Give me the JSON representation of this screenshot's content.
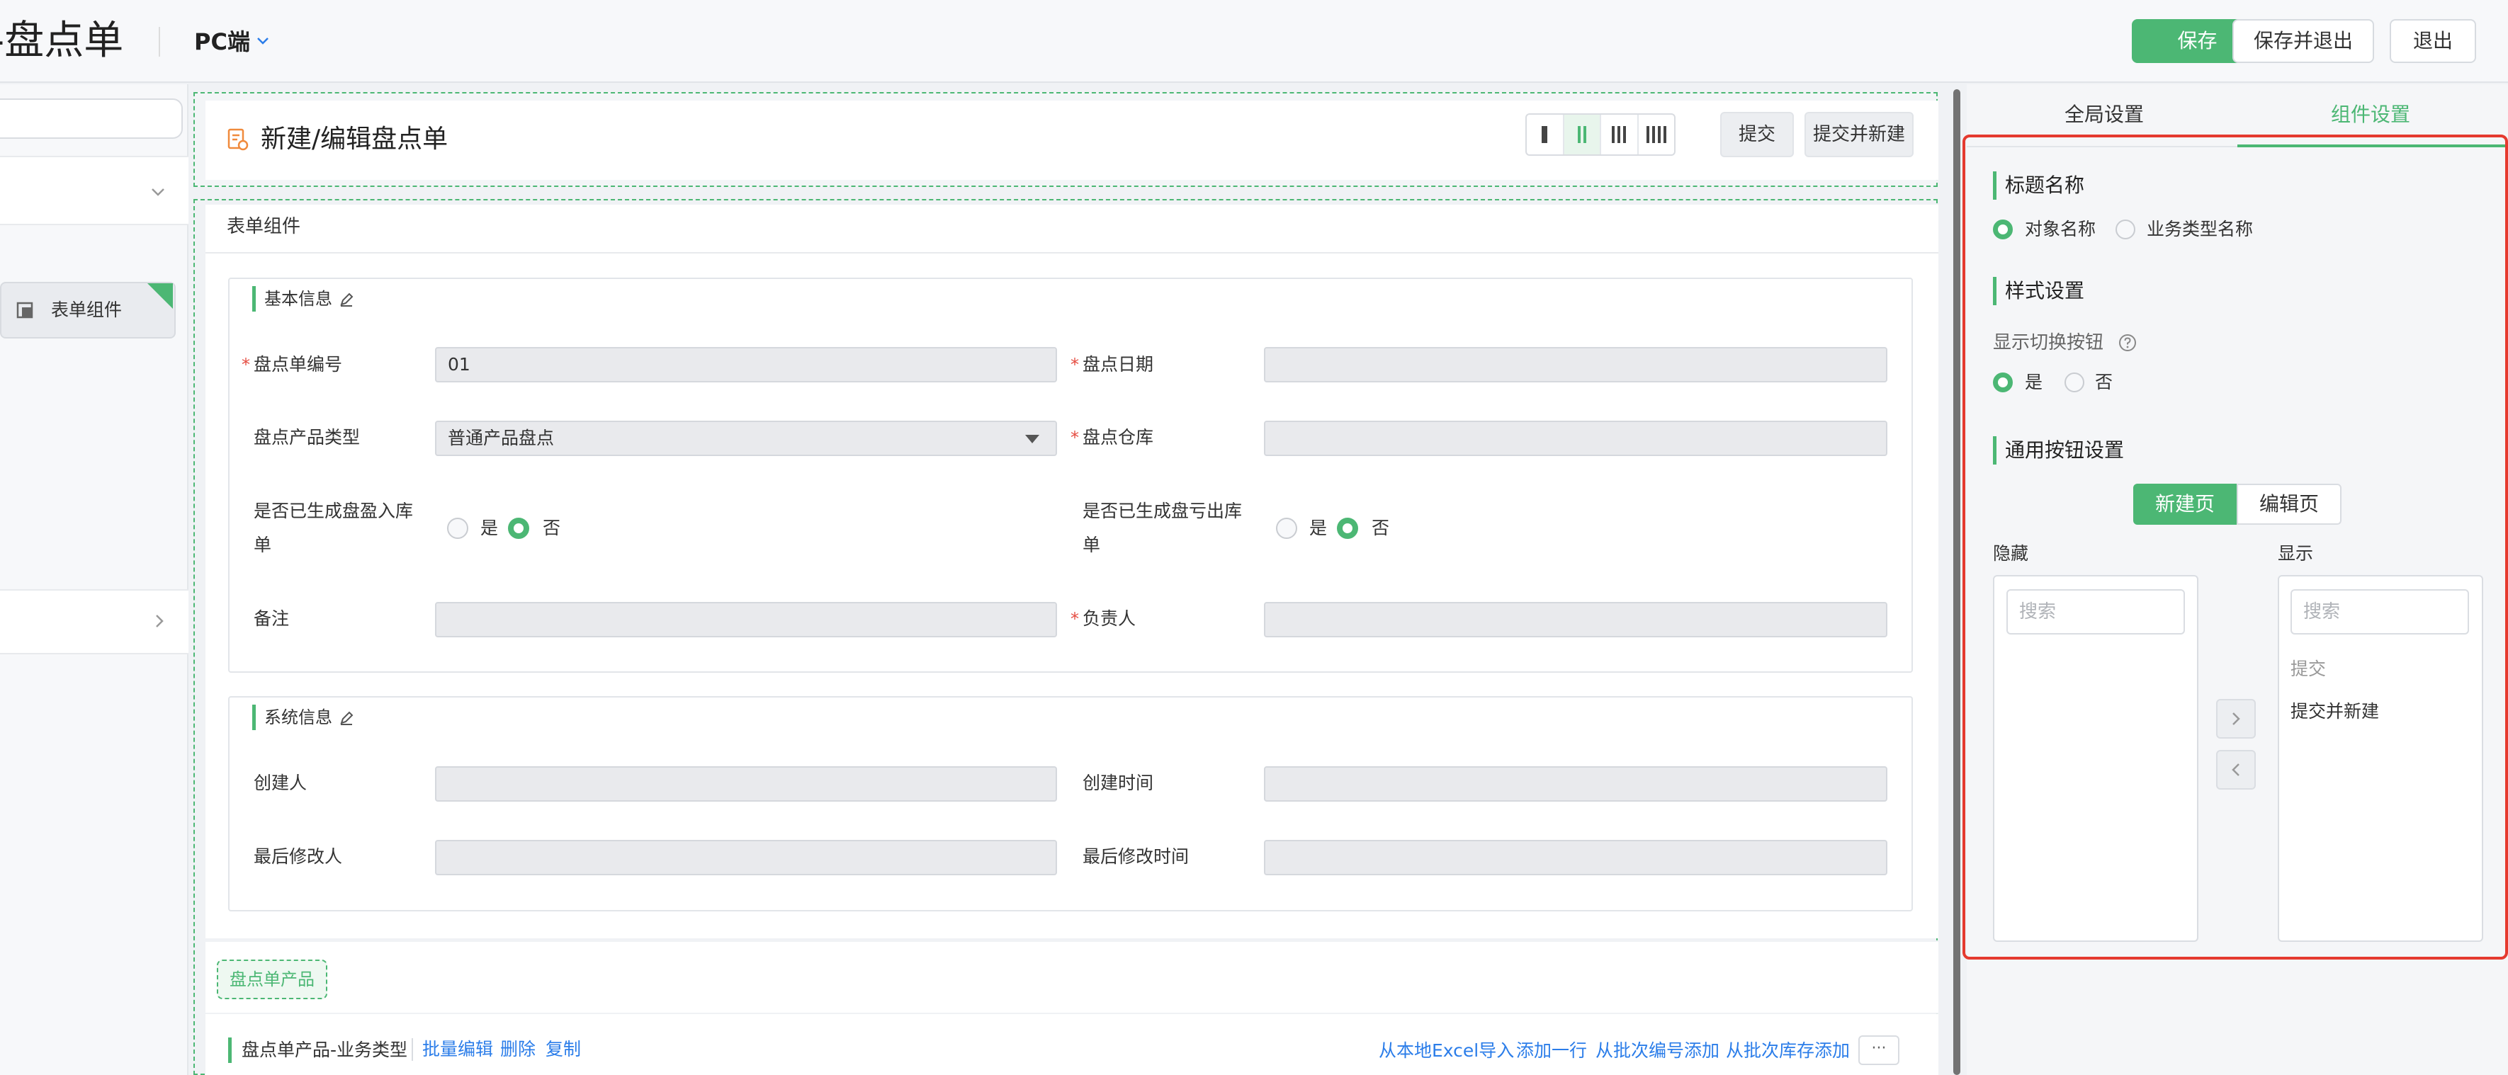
{
  "topbar": {
    "app_title": "-盘点单",
    "platform": "PC端",
    "buttons": {
      "save": "保存",
      "save_exit": "保存并退出",
      "exit": "退出"
    }
  },
  "left_panel": {
    "component_label": "表单组件"
  },
  "canvas": {
    "header": {
      "title": "新建/编辑盘点单",
      "submit": "提交",
      "submit_new": "提交并新建"
    },
    "form_title": "表单组件",
    "basic_section": {
      "title": "基本信息",
      "fields": {
        "code": {
          "label": "盘点单编号",
          "value": "01"
        },
        "date": {
          "label": "盘点日期",
          "value": ""
        },
        "product_type": {
          "label": "盘点产品类型",
          "value": "普通产品盘点"
        },
        "warehouse": {
          "label": "盘点仓库",
          "value": ""
        },
        "gain_label_1": "是否已生成盘盈入库",
        "gain_label_2": "单",
        "loss_label_1": "是否已生成盘亏出库",
        "loss_label_2": "单",
        "yes": "是",
        "no": "否",
        "remark": {
          "label": "备注",
          "value": ""
        },
        "owner": {
          "label": "负责人",
          "value": ""
        }
      }
    },
    "system_section": {
      "title": "系统信息",
      "fields": {
        "creator": "创建人",
        "created_time": "创建时间",
        "modifier": "最后修改人",
        "modified_time": "最后修改时间"
      }
    },
    "tab_product": "盘点单产品",
    "sub_table": {
      "title": "盘点单产品-业务类型",
      "left_links": [
        "批量编辑",
        "删除",
        "复制"
      ],
      "right_links": [
        "从本地Excel导入",
        "添加一行",
        "从批次编号添加",
        "从批次库存添加"
      ],
      "more": "···"
    }
  },
  "right_panel": {
    "tabs": {
      "global": "全局设置",
      "component": "组件设置"
    },
    "title_name": {
      "heading": "标题名称",
      "option_object": "对象名称",
      "option_business": "业务类型名称",
      "selected": "对象名称"
    },
    "style": {
      "heading": "样式设置",
      "show_toggle_label": "显示切换按钮",
      "yes": "是",
      "no": "否",
      "selected": "是"
    },
    "common_buttons": {
      "heading": "通用按钮设置",
      "seg_new": "新建页",
      "seg_edit": "编辑页",
      "hidden_label": "隐藏",
      "shown_label": "显示",
      "search_placeholder": "搜索",
      "shown_items": [
        "提交",
        "提交并新建"
      ]
    }
  },
  "colors": {
    "accent": "#4cb774",
    "highlight_frame": "#e53a2f",
    "link": "#2b7de9"
  }
}
